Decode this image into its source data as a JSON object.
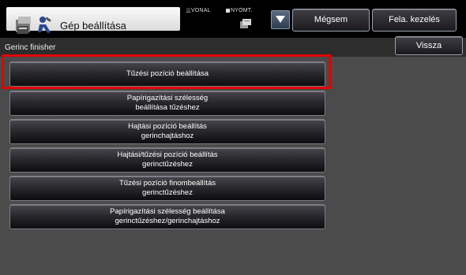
{
  "header": {
    "title": "Gép beállítása",
    "gear_icon": "gear-icon",
    "tool_icon": "tool-icon",
    "line_label": "VONAL",
    "print_label": "NYOMT.",
    "cancel_label": "Mégsem",
    "release_label": "Fela. kezelés"
  },
  "subheader": {
    "title": "Gerinc finisher",
    "back_label": "Vissza"
  },
  "menu": {
    "items": [
      {
        "line1": "Tűzési pozíció beállítása",
        "line2": ""
      },
      {
        "line1": "Papírigazítási szélesség",
        "line2": "beállítása tűzéshez"
      },
      {
        "line1": "Hajtási pozíció beállítás",
        "line2": "gerinchajtáshoz"
      },
      {
        "line1": "Hajtási/tűzési pozíció beállítás",
        "line2": "gerinctűzéshez"
      },
      {
        "line1": "Tűzési pozíció finombeállítás",
        "line2": "gerinctűzéshez"
      },
      {
        "line1": "Papírigazítási szélesség beállítása",
        "line2": "gerinctűzéshez/gerinchajtáshoz"
      }
    ],
    "highlight_color": "#e30000"
  }
}
